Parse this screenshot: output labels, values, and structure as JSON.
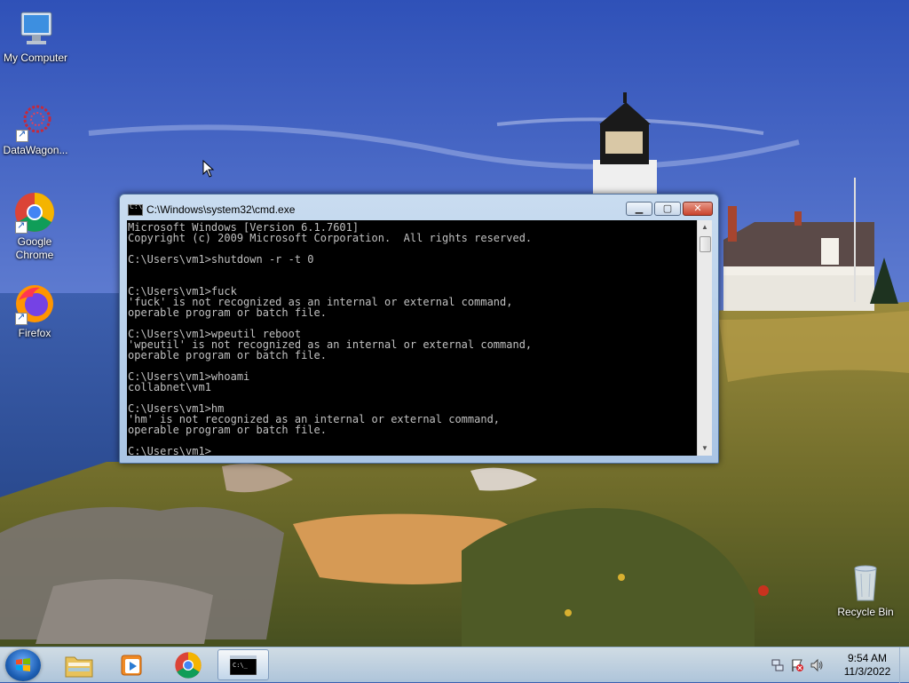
{
  "desktop": {
    "icons": [
      {
        "label": "My Computer",
        "icon": "computer-icon"
      },
      {
        "label": "DataWagon...",
        "icon": "datawagon-icon"
      },
      {
        "label": "Google Chrome",
        "icon": "chrome-icon"
      },
      {
        "label": "Firefox",
        "icon": "firefox-icon"
      },
      {
        "label": "Recycle Bin",
        "icon": "recycle-bin-icon"
      }
    ]
  },
  "cmd_window": {
    "title": "C:\\Windows\\system32\\cmd.exe",
    "icon_text": "C:\\",
    "buttons": {
      "minimize": "▁",
      "maximize": "▢",
      "close": "✕"
    },
    "console_text": "Microsoft Windows [Version 6.1.7601]\nCopyright (c) 2009 Microsoft Corporation.  All rights reserved.\n\nC:\\Users\\vm1>shutdown -r -t 0\n\n\nC:\\Users\\vm1>fuck\n'fuck' is not recognized as an internal or external command,\noperable program or batch file.\n\nC:\\Users\\vm1>wpeutil reboot\n'wpeutil' is not recognized as an internal or external command,\noperable program or batch file.\n\nC:\\Users\\vm1>whoami\ncollabnet\\vm1\n\nC:\\Users\\vm1>hm\n'hm' is not recognized as an internal or external command,\noperable program or batch file.\n\nC:\\Users\\vm1>"
  },
  "taskbar": {
    "pinned": [
      {
        "name": "windows-explorer",
        "icon": "folder-icon"
      },
      {
        "name": "media-player",
        "icon": "media-player-icon"
      },
      {
        "name": "google-chrome",
        "icon": "chrome-icon"
      },
      {
        "name": "command-prompt",
        "icon": "cmd-icon",
        "active": true
      }
    ],
    "tray": {
      "icons": [
        "network-icon",
        "action-center-flag-icon",
        "volume-icon"
      ],
      "time": "9:54 AM",
      "date": "11/3/2022"
    }
  },
  "colors": {
    "console_bg": "#000000",
    "console_fg": "#c0c0c0",
    "close_button": "#c9432c"
  }
}
